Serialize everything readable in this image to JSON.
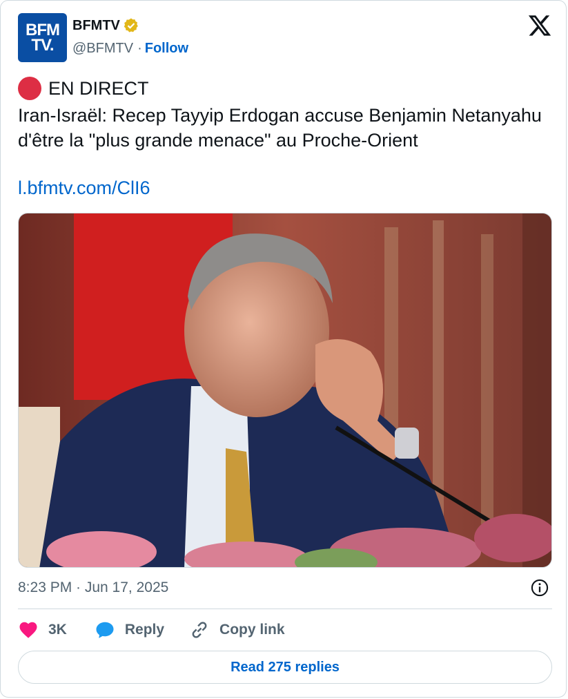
{
  "account": {
    "logo_line1": "BFM",
    "logo_line2": "TV.",
    "name": "BFMTV",
    "handle": "@BFMTV",
    "separator": "·",
    "follow_label": "Follow"
  },
  "tweet": {
    "live_label": "EN DIRECT",
    "text": "Iran-Israël: Recep Tayyip Erdogan accuse Benjamin Netanyahu d'être la \"plus grande menace\" au Proche-Orient",
    "link": "l.bfmtv.com/ClI6",
    "timestamp": "8:23 PM · Jun 17, 2025"
  },
  "actions": {
    "likes_count": "3K",
    "reply_label": "Reply",
    "copy_link_label": "Copy link",
    "read_replies_label": "Read 275 replies"
  },
  "colors": {
    "accent": "#0066cc",
    "like": "#f91880",
    "reply": "#1d9bf0",
    "verified": "#e2b719",
    "live": "#dd2e44",
    "logo_bg": "#0a4ea3"
  },
  "icons": [
    "x-logo-icon",
    "verified-badge-icon",
    "live-dot-icon",
    "info-icon",
    "heart-icon",
    "reply-bubble-icon",
    "link-icon"
  ]
}
